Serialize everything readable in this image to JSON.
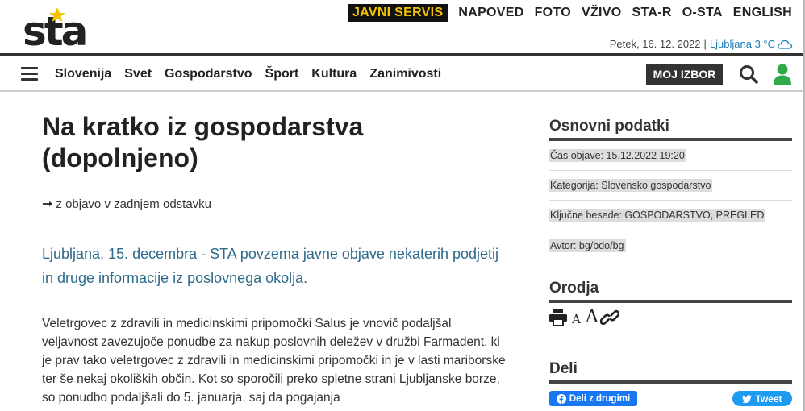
{
  "brand": {
    "logo_text": "sta",
    "accent": "#f5c400"
  },
  "topnav": [
    "JAVNI SERVIS",
    "NAPOVED",
    "FOTO",
    "VŽIVO",
    "STA-R",
    "O-STA",
    "ENGLISH"
  ],
  "dateline": {
    "date": "Petek, 16. 12. 2022",
    "separator": "|",
    "city_weather": "Ljubljana 3 °C",
    "weather_icon": "cloud-icon"
  },
  "mainnav": {
    "categories": [
      "Slovenija",
      "Svet",
      "Gospodarstvo",
      "Šport",
      "Kultura",
      "Zanimivosti"
    ],
    "moj_izbor": "MOJ IZBOR"
  },
  "article": {
    "title": "Na kratko iz gospodarstva (dopolnjeno)",
    "note_arrow": "➞",
    "note": "z objavo v zadnjem odstavku",
    "lead": "Ljubljana, 15. decembra - STA povzema javne objave nekaterih podjetij in druge informacije iz poslovnega okolja.",
    "body": "Veletrgovec z zdravili in medicinskimi pripomočki Salus je vnovič podaljšal veljavnost zavezujoče ponudbe za nakup poslovnih deležev v družbi Farmadent, ki je prav tako veletrgovec z zdravili in medicinskimi pripomočki in je v lasti mariborske ter še nekaj okoliških občin. Kot so sporočili preko spletne strani Ljubljanske borze, so ponudbo podaljšali do 5. januarja, saj da pogajanja"
  },
  "sidebar": {
    "basic_title": "Osnovni podatki",
    "basic_rows": [
      "Čas objave: 15.12.2022 19:20",
      "Kategorija: Slovensko gospodarstvo",
      "Ključne besede: GOSPODARSTVO, PREGLED",
      "Avtor: bg/bdo/bg"
    ],
    "tools_title": "Orodja",
    "tools": {
      "small_a": "A",
      "big_a": "A"
    },
    "share_title": "Deli",
    "facebook": "Deli z drugimi",
    "twitter": "Tweet"
  }
}
